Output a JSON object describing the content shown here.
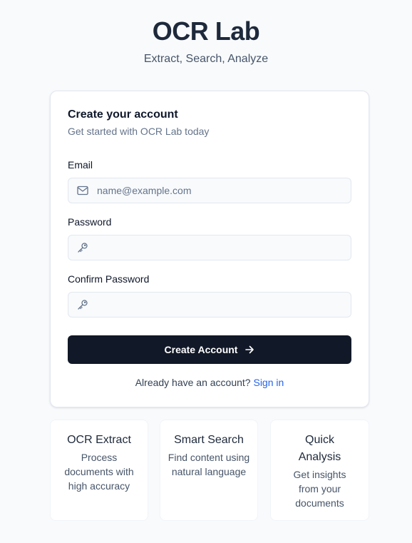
{
  "brand": {
    "title": "OCR Lab",
    "subtitle": "Extract, Search, Analyze"
  },
  "card": {
    "title": "Create your account",
    "subtitle": "Get started with OCR Lab today"
  },
  "fields": {
    "email": {
      "label": "Email",
      "placeholder": "name@example.com",
      "value": "",
      "icon": "mail-icon"
    },
    "password": {
      "label": "Password",
      "placeholder": "",
      "value": "",
      "icon": "key-icon"
    },
    "confirm_password": {
      "label": "Confirm Password",
      "placeholder": "",
      "value": "",
      "icon": "key-icon"
    }
  },
  "submit": {
    "label": "Create Account",
    "icon": "arrow-right-icon"
  },
  "signin": {
    "prompt": "Already have an account?",
    "link": "Sign in"
  },
  "features": [
    {
      "title": "OCR Extract",
      "description": "Process documents with high accuracy"
    },
    {
      "title": "Smart Search",
      "description": "Find content using natural language"
    },
    {
      "title": "Quick Analysis",
      "description": "Get insights from your documents"
    }
  ],
  "colors": {
    "background": "#f8fafc",
    "primary_button": "#111827",
    "link": "#2563eb",
    "title": "#1e293b"
  }
}
